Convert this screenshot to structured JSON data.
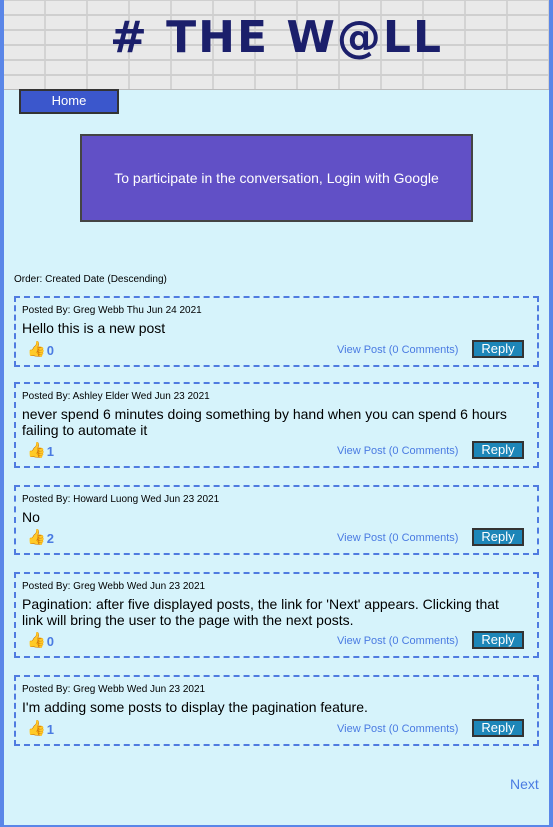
{
  "banner": {
    "title": "# THE W@LL"
  },
  "nav": {
    "home_label": "Home"
  },
  "login": {
    "text": "To participate in the conversation, Login with Google"
  },
  "order": {
    "text": "Order: Created Date (Descending)"
  },
  "posts": [
    {
      "meta": "Posted By: Greg Webb Thu Jun 24 2021",
      "body": "Hello this is a new post",
      "likes": "0",
      "view": "View Post (0 Comments)",
      "reply": "Reply"
    },
    {
      "meta": "Posted By: Ashley Elder Wed Jun 23 2021",
      "body": "never spend 6 minutes doing something by hand when you can spend 6 hours failing to automate it",
      "likes": "1",
      "view": "View Post (0 Comments)",
      "reply": "Reply"
    },
    {
      "meta": "Posted By: Howard Luong Wed Jun 23 2021",
      "body": "No",
      "likes": "2",
      "view": "View Post (0 Comments)",
      "reply": "Reply"
    },
    {
      "meta": "Posted By: Greg Webb Wed Jun 23 2021",
      "body": "Pagination: after five displayed posts, the link for 'Next' appears. Clicking that link will bring the user to the page with the next posts.",
      "likes": "0",
      "view": "View Post (0 Comments)",
      "reply": "Reply"
    },
    {
      "meta": "Posted By: Greg Webb Wed Jun 23 2021",
      "body": "I'm adding some posts to display the pagination feature.",
      "likes": "1",
      "view": "View Post (0 Comments)",
      "reply": "Reply"
    }
  ],
  "pagination": {
    "next_label": "Next"
  },
  "icons": {
    "like": "thumbs-up-icon"
  },
  "colors": {
    "background": "#d6f3fb",
    "accent": "#4a7be2",
    "login": "#6150c6",
    "reply": "#1d86b8",
    "home": "#3b57cc"
  }
}
